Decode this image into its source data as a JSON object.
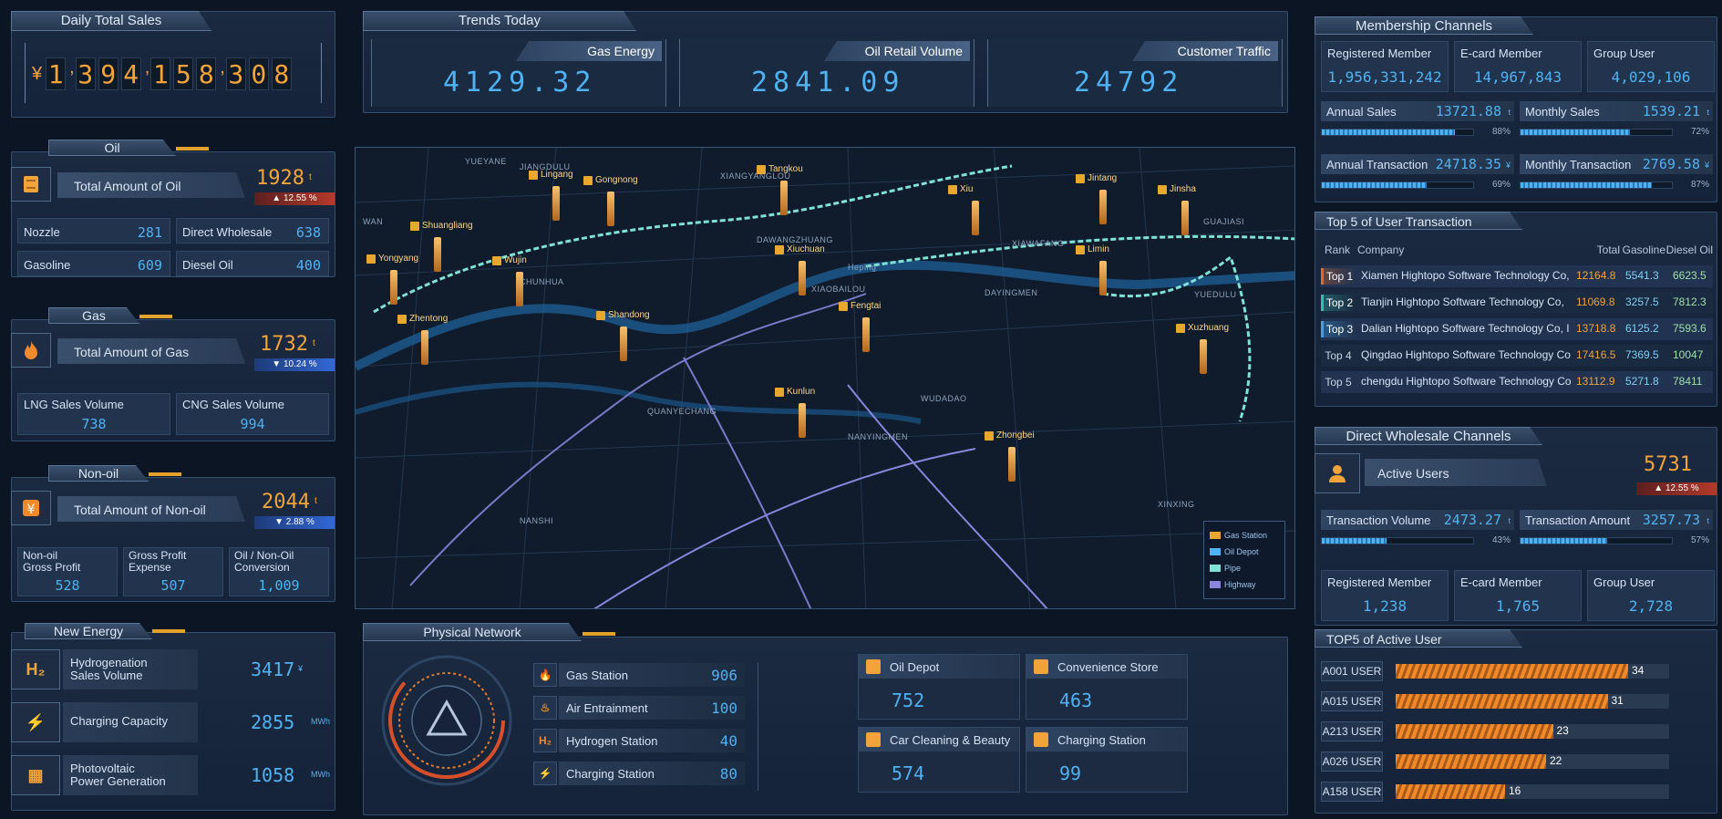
{
  "daily_sales": {
    "title": "Daily Total Sales",
    "currency": "¥",
    "digits": [
      "1",
      ",",
      "3",
      "9",
      "4",
      ",",
      "1",
      "5",
      "8",
      ",",
      "3",
      "0",
      "8"
    ]
  },
  "trends": {
    "title": "Trends Today",
    "items": [
      {
        "label": "Gas Energy",
        "value": "4129.32"
      },
      {
        "label": "Oil Retail Volume",
        "value": "2841.09"
      },
      {
        "label": "Customer Traffic",
        "value": "24792"
      }
    ]
  },
  "oil": {
    "title": "Oil",
    "total_label": "Total Amount of Oil",
    "total": "1928",
    "unit": "t",
    "delta": "12.55",
    "delta_unit": "%",
    "cells": [
      {
        "label": "Nozzle",
        "value": "281"
      },
      {
        "label": "Direct Wholesale",
        "value": "638"
      },
      {
        "label": "Gasoline",
        "value": "609"
      },
      {
        "label": "Diesel Oil",
        "value": "400"
      }
    ]
  },
  "gas": {
    "title": "Gas",
    "total_label": "Total Amount of Gas",
    "total": "1732",
    "unit": "t",
    "delta": "10.24",
    "delta_unit": "%",
    "cells": [
      {
        "label": "LNG Sales Volume",
        "value": "738"
      },
      {
        "label": "CNG Sales Volume",
        "value": "994"
      }
    ]
  },
  "nonoil": {
    "title": "Non-oil",
    "total_label": "Total Amount of Non-oil",
    "total": "2044",
    "unit": "t",
    "delta": "2.88",
    "delta_unit": "%",
    "cells": [
      {
        "label1": "Non-oil",
        "label2": "Gross Profit",
        "value": "528"
      },
      {
        "label1": "Gross Profit",
        "label2": "Expense",
        "value": "507"
      },
      {
        "label1": "Oil / Non-Oil",
        "label2": "Conversion",
        "value": "1,009"
      }
    ]
  },
  "new_energy": {
    "title": "New Energy",
    "items": [
      {
        "label1": "Hydrogenation",
        "label2": "Sales Volume",
        "value": "3417",
        "unit": "¥",
        "icon": "H₂"
      },
      {
        "label1": "Charging Capacity",
        "label2": "",
        "value": "2855",
        "unit": "MWh",
        "icon": "⚡"
      },
      {
        "label1": "Photovoltaic",
        "label2": "Power Generation",
        "value": "1058",
        "unit": "MWh",
        "icon": "▦"
      }
    ]
  },
  "physical": {
    "title": "Physical Network",
    "list": [
      {
        "label": "Gas Station",
        "value": "906",
        "icon": "🔥"
      },
      {
        "label": "Air Entrainment",
        "value": "100",
        "icon": "♨"
      },
      {
        "label": "Hydrogen Station",
        "value": "40",
        "icon": "H₂"
      },
      {
        "label": "Charging Station",
        "value": "80",
        "icon": "⚡"
      }
    ],
    "cards": [
      {
        "label": "Oil Depot",
        "value": "752"
      },
      {
        "label": "Convenience Store",
        "value": "463"
      },
      {
        "label": "Car Cleaning & Beauty",
        "value": "574"
      },
      {
        "label": "Charging Station",
        "value": "99"
      }
    ]
  },
  "membership": {
    "title": "Membership Channels",
    "counts": [
      {
        "label": "Registered Member",
        "value": "1,956,331,242"
      },
      {
        "label": "E-card Member",
        "value": "14,967,843"
      },
      {
        "label": "Group User",
        "value": "4,029,106"
      }
    ],
    "metrics": [
      {
        "label": "Annual Sales",
        "value": "13721.88",
        "unit": "t",
        "pct": "88%",
        "frac": 0.88
      },
      {
        "label": "Monthly Sales",
        "value": "1539.21",
        "unit": "t",
        "pct": "72%",
        "frac": 0.72
      },
      {
        "label": "Annual Transaction",
        "value": "24718.35",
        "unit": "¥",
        "pct": "69%",
        "frac": 0.69
      },
      {
        "label": "Monthly Transaction",
        "value": "2769.58",
        "unit": "¥",
        "pct": "87%",
        "frac": 0.87
      }
    ]
  },
  "top5": {
    "title": "Top 5 of User Transaction",
    "headers": [
      "Rank",
      "Company",
      "Total",
      "Gasoline",
      "Diesel Oil"
    ],
    "rows": [
      {
        "rank": "Top 1",
        "company": "Xiamen Hightopo Software Technology Co,",
        "total": "12164.8",
        "gas": "5541.3",
        "diesel": "6623.5"
      },
      {
        "rank": "Top 2",
        "company": "Tianjin Hightopo Software Technology Co,",
        "total": "11069.8",
        "gas": "3257.5",
        "diesel": "7812.3"
      },
      {
        "rank": "Top 3",
        "company": "Dalian Hightopo Software Technology Co, I",
        "total": "13718.8",
        "gas": "6125.2",
        "diesel": "7593.6"
      },
      {
        "rank": "Top 4",
        "company": "Qingdao Hightopo Software Technology Co",
        "total": "17416.5",
        "gas": "7369.5",
        "diesel": "10047"
      },
      {
        "rank": "Top 5",
        "company": "chengdu Hightopo Software Technology Co",
        "total": "13112.9",
        "gas": "5271.8",
        "diesel": "78411"
      }
    ]
  },
  "wholesale": {
    "title": "Direct Wholesale Channels",
    "active_label": "Active Users",
    "active": "5731",
    "delta": "12.55",
    "delta_unit": "%",
    "metrics": [
      {
        "label": "Transaction Volume",
        "value": "2473.27",
        "unit": "t",
        "pct": "43%",
        "frac": 0.43
      },
      {
        "label": "Transaction Amount",
        "value": "3257.73",
        "unit": "t",
        "pct": "57%",
        "frac": 0.57
      }
    ],
    "counts": [
      {
        "label": "Registered Member",
        "value": "1,238"
      },
      {
        "label": "E-card Member",
        "value": "1,765"
      },
      {
        "label": "Group User",
        "value": "2,728"
      }
    ]
  },
  "top_active": {
    "title": "TOP5 of Active User",
    "rows": [
      {
        "name": "A001 USER",
        "value": 34
      },
      {
        "name": "A015 USER",
        "value": 31
      },
      {
        "name": "A213 USER",
        "value": 23
      },
      {
        "name": "A026 USER",
        "value": 22
      },
      {
        "name": "A158 USER",
        "value": 16
      }
    ]
  },
  "map": {
    "legend": [
      {
        "label": "Gas Station"
      },
      {
        "label": "Oil Depot"
      },
      {
        "label": "Pipe"
      },
      {
        "label": "Highway"
      }
    ],
    "stations": [
      "Lingang",
      "Gongnong",
      "Tangkou",
      "Xiu",
      "Jintang",
      "Jinsha",
      "Shuangliang",
      "Yongyang",
      "Wujin",
      "Xiuchuan",
      "Limin",
      "Zhentong",
      "Shandong",
      "Fengtai",
      "Xuzhuang",
      "Kunlun",
      "Zhongbei"
    ],
    "districts": [
      "YUEYANE",
      "JIANGDULU",
      "XIANGYANGLOU",
      "DAYINGMEN",
      "QUANYECHANG",
      "WUDADAO",
      "NANYINGMEN",
      "NANSHI",
      "XINXING",
      "XIAOBAILOU",
      "GUAJIASI",
      "YUEDULU",
      "XIAWAFANG",
      "DAWANGZHUANG",
      "CHUNHUA",
      "WAN",
      "Heping"
    ]
  },
  "colors": {
    "accent": "#4fb2f2",
    "orange": "#f2a33a",
    "panel": "#1b2a40"
  }
}
